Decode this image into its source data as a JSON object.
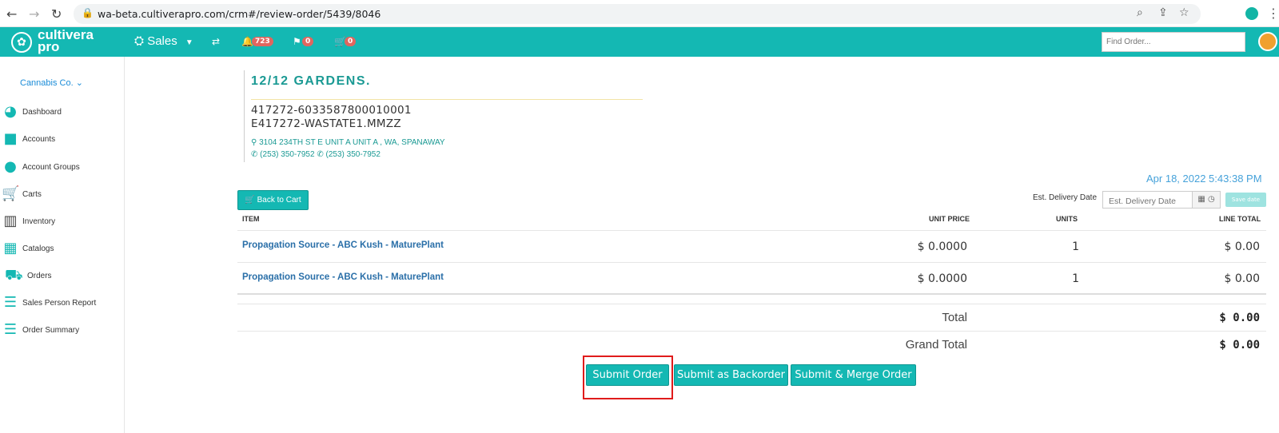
{
  "browser": {
    "url": "wa-beta.cultiverapro.com/crm#/review-order/5439/8046"
  },
  "topbar": {
    "logo_line1": "cultivera",
    "logo_line2": "pro",
    "sales_label": "Sales",
    "notifications_count": "723",
    "flags_count": "0",
    "cart_count": "0",
    "find_order_placeholder": "Find Order..."
  },
  "sidebar": {
    "company": "Cannabis Co.",
    "items": [
      {
        "label": "Dashboard",
        "icon": "pie-chart-icon"
      },
      {
        "label": "Accounts",
        "icon": "briefcase-icon"
      },
      {
        "label": "Account Groups",
        "icon": "users-icon"
      },
      {
        "label": "Carts",
        "icon": "cart-icon"
      },
      {
        "label": "Inventory",
        "icon": "barcode-icon"
      },
      {
        "label": "Catalogs",
        "icon": "grid-icon"
      },
      {
        "label": "Orders",
        "icon": "cart-outline-icon"
      },
      {
        "label": "Sales Person Report",
        "icon": "list-icon"
      },
      {
        "label": "Order Summary",
        "icon": "list-icon"
      }
    ]
  },
  "account": {
    "name": "12/12 GARDENS.",
    "license1": "417272-6033587800010001",
    "license2": "E417272-WASTATE1.MMZZ",
    "address": "3104 234TH ST E UNIT A UNIT A , WA, SPANAWAY",
    "phone1": "(253) 350-7952",
    "phone2": "(253) 350-7952"
  },
  "order": {
    "timestamp": "Apr 18, 2022 5:43:38 PM",
    "back_label": "Back to Cart",
    "est_delivery_label": "Est. Delivery Date",
    "est_delivery_placeholder": "Est. Delivery Date",
    "save_date_label": "Save date",
    "columns": {
      "item": "ITEM",
      "unit_price": "UNIT PRICE",
      "units": "UNITS",
      "line_total": "LINE TOTAL"
    },
    "rows": [
      {
        "item": "Propagation Source - ABC Kush - MaturePlant",
        "unit_price": "$ 0.0000",
        "units": "1",
        "line_total": "$ 0.00"
      },
      {
        "item": "Propagation Source - ABC Kush - MaturePlant",
        "unit_price": "$ 0.0000",
        "units": "1",
        "line_total": "$ 0.00"
      }
    ],
    "total_label": "Total",
    "total_value": "$ 0.00",
    "grand_total_label": "Grand Total",
    "grand_total_value": "$ 0.00",
    "submit_label": "Submit Order",
    "backorder_label": "Submit as Backorder",
    "merge_label": "Submit & Merge Order"
  },
  "colors": {
    "brand": "#14b8b3",
    "link": "#2a6fa8",
    "highlight": "#e01b1b"
  }
}
